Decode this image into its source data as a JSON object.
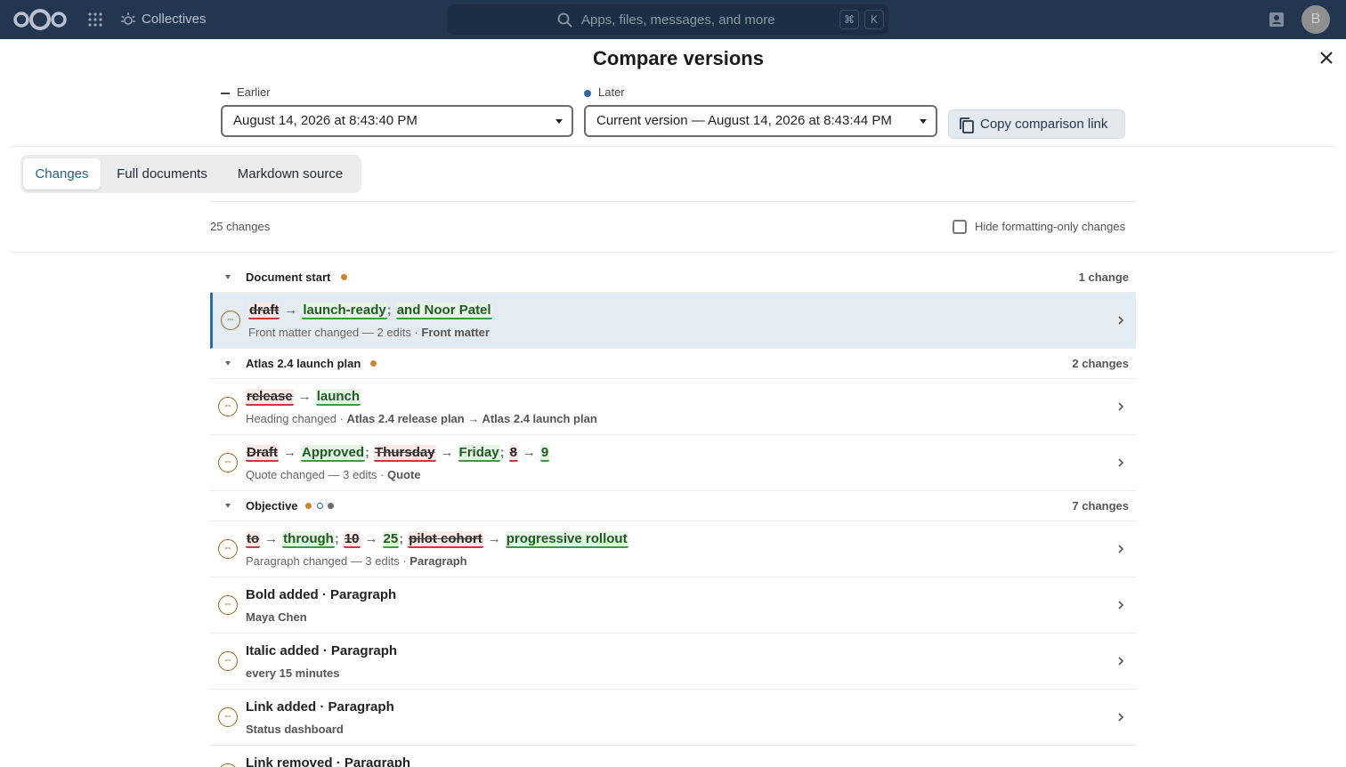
{
  "topbar": {
    "app_name": "Collectives",
    "search_placeholder": "Apps, files, messages, and more",
    "kbd_cmd": "⌘",
    "kbd_k": "K",
    "avatar_initial": "B"
  },
  "dialog": {
    "title": "Compare versions",
    "earlier_label": "Earlier",
    "later_label": "Later",
    "earlier_value": "August 14, 2026 at 8:43:40 PM",
    "later_value": "Current version — August 14, 2026 at 8:43:44 PM",
    "copy_label": "Copy comparison link"
  },
  "tabs": [
    {
      "label": "Changes"
    },
    {
      "label": "Full documents"
    },
    {
      "label": "Markdown source"
    }
  ],
  "summary": {
    "count": "25 changes",
    "hide_label": "Hide formatting-only changes"
  },
  "groups": [
    {
      "title": "Document start",
      "count": "1 change"
    },
    {
      "title": "Atlas 2.4 launch plan",
      "count": "2 changes"
    },
    {
      "title": "Objective",
      "count": "7 changes"
    }
  ],
  "rows": [
    {
      "edits": [
        {
          "del": "draft",
          "ins": "launch-ready"
        },
        {
          "ins": "and Noor Patel"
        }
      ],
      "meta": "Front matter changed — 2 edits",
      "context": "Front matter"
    },
    {
      "edits": [
        {
          "del": "release",
          "ins": "launch"
        }
      ],
      "meta": "Heading changed",
      "context": "Atlas 2.4 release plan → Atlas 2.4 launch plan"
    },
    {
      "edits": [
        {
          "del": "Draft",
          "ins": "Approved"
        },
        {
          "del": "Thursday",
          "ins": "Friday"
        },
        {
          "del": "8",
          "ins": "9"
        }
      ],
      "meta": "Quote changed — 3 edits",
      "context": "Quote"
    },
    {
      "edits": [
        {
          "del": "to",
          "ins": "through"
        },
        {
          "del": "10",
          "ins": "25"
        },
        {
          "del": "pilot cohort",
          "ins": "progressive rollout"
        }
      ],
      "meta": "Paragraph changed — 3 edits",
      "context": "Paragraph"
    },
    {
      "title": "Bold added",
      "title_context": "Paragraph",
      "sub": "Maya Chen"
    },
    {
      "title": "Italic added",
      "title_context": "Paragraph",
      "sub": "every 15 minutes"
    },
    {
      "title": "Link added",
      "title_context": "Paragraph",
      "sub": "Status dashboard"
    },
    {
      "title": "Link removed",
      "title_context": "Paragraph",
      "sub": ""
    }
  ],
  "colors": {
    "topbar": "#23364f",
    "accent": "#2d6aa1",
    "deleted": "#d3363a",
    "inserted": "#3e9a44",
    "dot_orange": "#c9862c",
    "dot_blue": "#2d6aa1",
    "dot_gray": "#6b6b6b"
  },
  "icons": {
    "logo": "nextcloud-logo",
    "apps": "grid-icon",
    "app": "collectives-icon",
    "search": "search-icon",
    "contacts": "contacts-icon",
    "close": "close-icon",
    "copy": "copy-icon",
    "row": "compare-arrows-icon",
    "chevron": "chevron-right-icon"
  }
}
